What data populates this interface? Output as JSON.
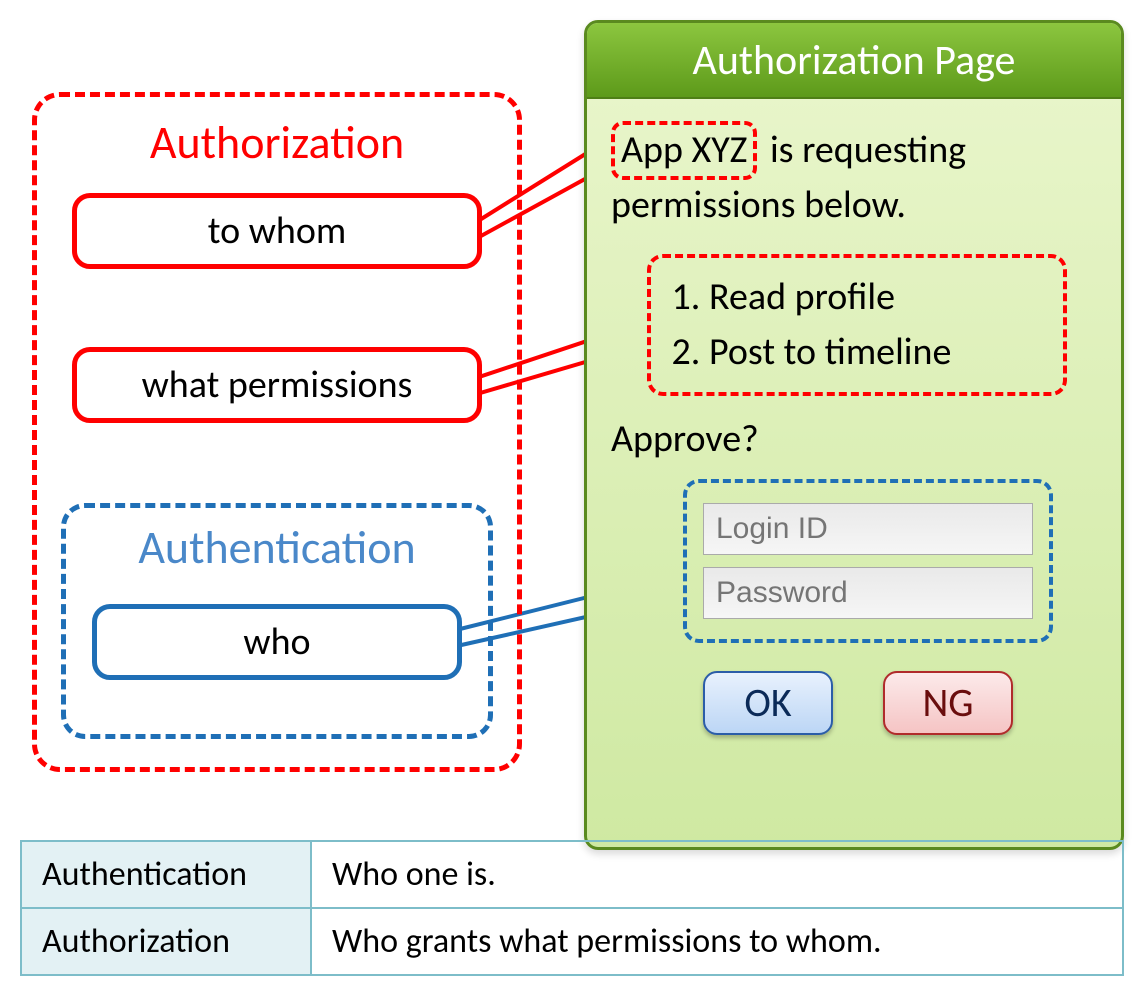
{
  "left": {
    "authorization_title": "Authorization",
    "to_whom_label": "to whom",
    "what_permissions_label": "what permissions",
    "authentication_title": "Authentication",
    "who_label": "who"
  },
  "page": {
    "header": "Authorization Page",
    "app_name": "App XYZ",
    "request_tail": " is requesting permissions below.",
    "permissions": [
      "Read profile",
      "Post to timeline"
    ],
    "approve_label": "Approve?",
    "login_id_placeholder": "Login ID",
    "password_placeholder": "Password",
    "ok_label": "OK",
    "ng_label": "NG"
  },
  "table": {
    "rows": [
      {
        "term": "Authentication",
        "desc": "Who one is."
      },
      {
        "term": "Authorization",
        "desc": "Who grants what permissions to whom."
      }
    ]
  },
  "colors": {
    "red": "#ff0000",
    "blue": "#1f6fb6",
    "green_header_top": "#8cc63f",
    "green_header_bot": "#5d9a1a",
    "panel_top": "#eaf6cd",
    "panel_bot": "#cfe9a2"
  }
}
